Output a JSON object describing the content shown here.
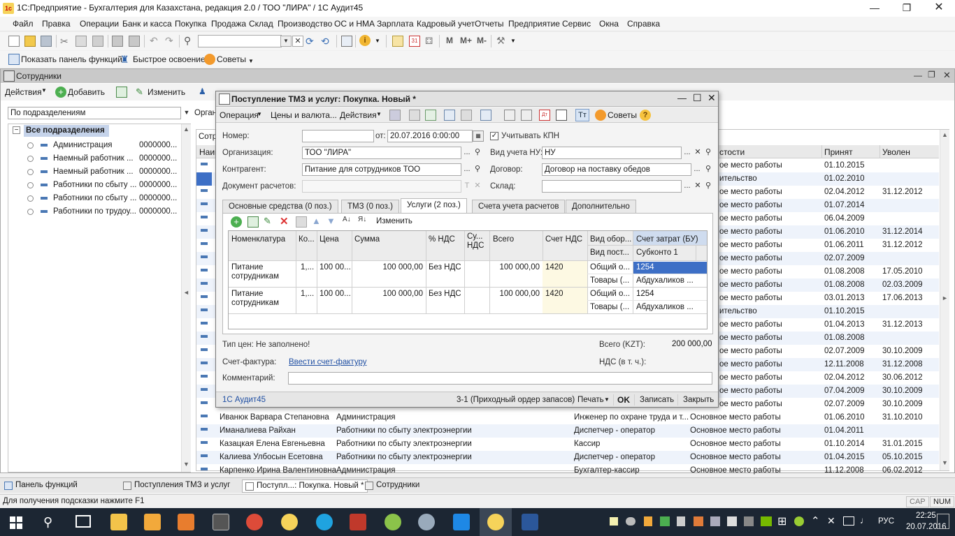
{
  "app": {
    "title": "1С:Предприятие - Бухгалтерия для Казахстана, редакция 2.0 / ТОО \"ЛИРА\" / 1С Аудит45",
    "logo": "1с"
  },
  "menu": [
    "Файл",
    "Правка",
    "Операции",
    "Банк и касса",
    "Покупка",
    "Продажа",
    "Склад",
    "Производство",
    "ОС и НМА",
    "Зарплата",
    "Кадровый учет",
    "Отчеты",
    "Предприятие",
    "Сервис",
    "Окна",
    "Справка"
  ],
  "toolbar2": {
    "show_panel": "Показать панель функций",
    "quick": "Быстрое освоение",
    "tips": "Советы",
    "kz": [
      "М",
      "М+",
      "М-"
    ]
  },
  "employees": {
    "title": "Сотрудники",
    "actions": "Действия",
    "add": "Добавить",
    "edit": "Изменить",
    "filter_value": "По подразделениям",
    "org_label": "Орган",
    "tree_root": "Все подразделения",
    "tree": [
      {
        "name": "Администрация",
        "code": "0000000..."
      },
      {
        "name": "Наемный работник ...",
        "code": "0000000..."
      },
      {
        "name": "Наемный работник ...",
        "code": "0000000..."
      },
      {
        "name": "Работники по сбыту ...",
        "code": "0000000..."
      },
      {
        "name": "Работники по сбыту ...",
        "code": "0000000..."
      },
      {
        "name": "Работники по трудоу...",
        "code": "0000000..."
      }
    ],
    "list_label": "Сотр",
    "col_name": "Наим",
    "col_place": "стости",
    "col_hired": "Принят",
    "col_fired": "Уволен",
    "right_rows": [
      {
        "place": "ое место работы",
        "hired": "01.10.2015",
        "fired": ""
      },
      {
        "place": "ительство",
        "hired": "01.02.2010",
        "fired": ""
      },
      {
        "place": "ое место работы",
        "hired": "02.04.2012",
        "fired": "31.12.2012"
      },
      {
        "place": "ое место работы",
        "hired": "01.07.2014",
        "fired": ""
      },
      {
        "place": "ое место работы",
        "hired": "06.04.2009",
        "fired": ""
      },
      {
        "place": "ое место работы",
        "hired": "01.06.2010",
        "fired": "31.12.2014"
      },
      {
        "place": "ое место работы",
        "hired": "01.06.2011",
        "fired": "31.12.2012"
      },
      {
        "place": "ое место работы",
        "hired": "02.07.2009",
        "fired": ""
      },
      {
        "place": "ое место работы",
        "hired": "01.08.2008",
        "fired": "17.05.2010"
      },
      {
        "place": "ое место работы",
        "hired": "01.08.2008",
        "fired": "02.03.2009"
      },
      {
        "place": "ое место работы",
        "hired": "03.01.2013",
        "fired": "17.06.2013"
      },
      {
        "place": "ительство",
        "hired": "01.10.2015",
        "fired": ""
      },
      {
        "place": "ое место работы",
        "hired": "01.04.2013",
        "fired": "31.12.2013"
      },
      {
        "place": "ое место работы",
        "hired": "01.08.2008",
        "fired": ""
      },
      {
        "place": "ое место работы",
        "hired": "02.07.2009",
        "fired": "30.10.2009"
      },
      {
        "place": "ое место работы",
        "hired": "12.11.2008",
        "fired": "31.12.2008"
      },
      {
        "place": "ое место работы",
        "hired": "02.04.2012",
        "fired": "30.06.2012"
      },
      {
        "place": "ое место работы",
        "hired": "07.04.2009",
        "fired": "30.10.2009"
      },
      {
        "place": "ое место работы",
        "hired": "02.07.2009",
        "fired": "30.10.2009"
      }
    ],
    "full_rows": [
      {
        "name": "Иванюк Варвара Степановна",
        "dept": "Администрация",
        "pos": "Инженер по охране труда и т...",
        "place": "Основное место работы",
        "hired": "01.06.2010",
        "fired": "31.10.2010"
      },
      {
        "name": "Иманалиева Райхан",
        "dept": "Работники по сбыту электроэнергии",
        "pos": "Диспетчер - оператор",
        "place": "Основное место работы",
        "hired": "01.04.2011",
        "fired": ""
      },
      {
        "name": "Казацкая Елена Евгеньевна",
        "dept": "Работники по сбыту электроэнергии",
        "pos": "Кассир",
        "place": "Основное место работы",
        "hired": "01.10.2014",
        "fired": "31.01.2015"
      },
      {
        "name": "Калиева Улбосын Есетовна",
        "dept": "Работники по сбыту электроэнергии",
        "pos": "Диспетчер - оператор",
        "place": "Основное место работы",
        "hired": "01.04.2015",
        "fired": "05.10.2015"
      },
      {
        "name": "Карпенко Ирина Валентиновна",
        "dept": "Администрация",
        "pos": "Бухгалтер-кассир",
        "place": "Основное место работы",
        "hired": "11.12.2008",
        "fired": "06.02.2012"
      }
    ]
  },
  "doc": {
    "title": "Поступление ТМЗ и услуг: Покупка. Новый *",
    "menu": {
      "operation": "Операция",
      "prices": "Цены и валюта...",
      "actions": "Действия",
      "tips": "Советы"
    },
    "labels": {
      "number": "Номер:",
      "from": "от:",
      "org": "Организация:",
      "contractor": "Контрагент:",
      "settle_doc": "Документ расчетов:",
      "kpn": "Учитывать КПН",
      "nu_type": "Вид учета НУ:",
      "contract": "Договор:",
      "warehouse": "Склад:"
    },
    "values": {
      "number": "",
      "date": "20.07.2016  0:00:00",
      "org": "ТОО \"ЛИРА\"",
      "contractor": "Питание для сотрудников ТОО",
      "settle_doc": "",
      "nu_type": "НУ",
      "contract": "Договор на поставку обедов",
      "warehouse": ""
    },
    "tabs": [
      "Основные средства (0 поз.)",
      "ТМЗ (0 поз.)",
      "Услуги (2 поз.)",
      "Счета учета расчетов",
      "Дополнительно"
    ],
    "active_tab": 2,
    "grid_edit": "Изменить",
    "cols": [
      "Номенклатура",
      "Ко...",
      "Цена",
      "Сумма",
      "% НДС",
      "Су... НДС",
      "Всего",
      "Счет НДС",
      "Вид обор...",
      "Счет затрат (БУ)"
    ],
    "subcols": {
      "vid": "Вид пост...",
      "subkonto": "Субконто 1"
    },
    "rows": [
      {
        "nom": "Питание сотрудникам",
        "qty": "1,...",
        "price": "100 00...",
        "sum": "100 000,00",
        "vat": "Без НДС",
        "vatsum": "",
        "total": "100 000,00",
        "vatacc": "1420",
        "vid1": "Общий о...",
        "vid2": "Товары (...",
        "acc": "1254",
        "sub": "Абдухаликов ..."
      },
      {
        "nom": "Питание сотрудникам",
        "qty": "1,...",
        "price": "100 00...",
        "sum": "100 000,00",
        "vat": "Без НДС",
        "vatsum": "",
        "total": "100 000,00",
        "vatacc": "1420",
        "vid1": "Общий о...",
        "vid2": "Товары (...",
        "acc": "1254",
        "sub": "Абдухаликов ..."
      }
    ],
    "price_type": "Тип цен: Не заполнено!",
    "total_label": "Всего (KZT):",
    "total": "200 000,00",
    "vat_label": "НДС (в т. ч.):",
    "invoice_label": "Счет-фактура:",
    "invoice_link": "Ввести счет-фактуру",
    "comment_label": "Комментарий:",
    "footer": {
      "user": "1С Аудит45",
      "order": "3-1 (Приходный ордер запасов)",
      "print": "Печать",
      "ok": "OK",
      "save": "Записать",
      "close": "Закрыть"
    }
  },
  "tasks": [
    "Панель функций",
    "Поступления ТМЗ и услуг",
    "Поступл...: Покупка. Новый *",
    "Сотрудники"
  ],
  "status": {
    "hint": "Для получения подсказки нажмите F1",
    "caps": "CAP",
    "num": "NUM"
  },
  "tray": {
    "lang": "РУС",
    "time": "22:25",
    "date": "20.07.2016"
  }
}
